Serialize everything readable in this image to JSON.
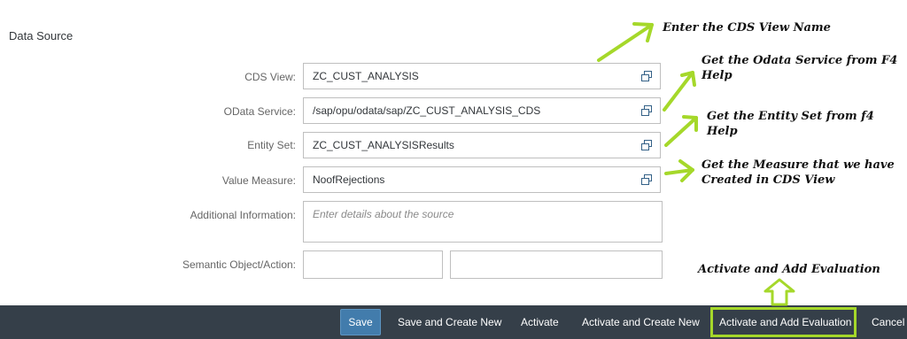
{
  "section": {
    "title": "Data Source"
  },
  "form": {
    "cds_view": {
      "label": "CDS View:",
      "value": "ZC_CUST_ANALYSIS"
    },
    "odata_service": {
      "label": "OData Service:",
      "value": "/sap/opu/odata/sap/ZC_CUST_ANALYSIS_CDS"
    },
    "entity_set": {
      "label": "Entity Set:",
      "value": "ZC_CUST_ANALYSISResults"
    },
    "value_measure": {
      "label": "Value Measure:",
      "value": "NoofRejections"
    },
    "additional_info": {
      "label": "Additional Information:",
      "placeholder": "Enter details about the source"
    },
    "semantic": {
      "label": "Semantic Object/Action:",
      "object_value": "",
      "action_value": ""
    }
  },
  "footer": {
    "save": "Save",
    "save_create_new": "Save and Create New",
    "activate": "Activate",
    "activate_create_new": "Activate and Create New",
    "activate_add_eval": "Activate and Add Evaluation",
    "cancel": "Cancel"
  },
  "annotations": {
    "cds": "Enter the CDS View Name",
    "odata_1": "Get the Odata Service from F4",
    "odata_2": "Help",
    "entity_1": "Get the Entity Set from f4",
    "entity_2": "Help",
    "measure_1": "Get the Measure that we have",
    "measure_2": "Created in CDS View",
    "activate": "Activate and Add Evaluation"
  },
  "colors": {
    "footer_bg": "#353f49",
    "save_bg": "#427cac",
    "annotation_green": "#a5d82a"
  },
  "icons": [
    "value-help-icon",
    "arrow-up-icon"
  ]
}
